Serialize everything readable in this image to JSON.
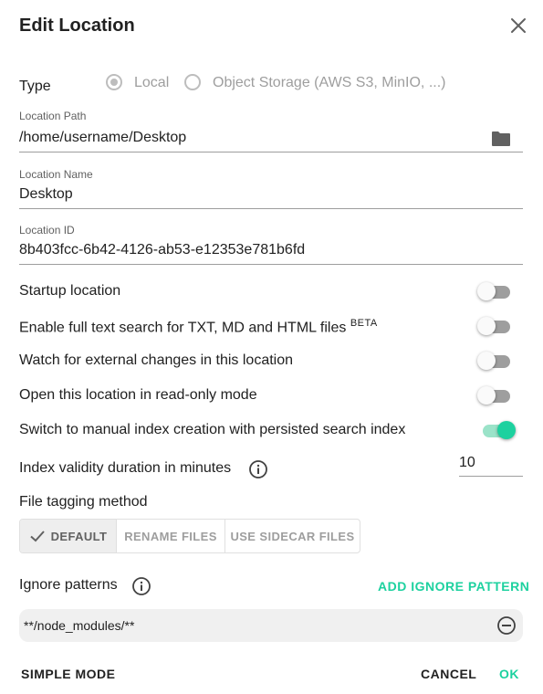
{
  "dialog": {
    "title": "Edit Location"
  },
  "type": {
    "label": "Type",
    "options": [
      {
        "label": "Local",
        "selected": true
      },
      {
        "label": "Object Storage (AWS S3, MinIO, ...)",
        "selected": false
      }
    ]
  },
  "fields": {
    "path": {
      "label": "Location Path",
      "value": "/home/username/Desktop"
    },
    "name": {
      "label": "Location Name",
      "value": "Desktop"
    },
    "id": {
      "label": "Location ID",
      "value": "8b403fcc-6b42-4126-ab53-e12353e781b6fd"
    }
  },
  "switches": [
    {
      "label": "Startup location",
      "on": false
    },
    {
      "label": "Enable full text search for TXT, MD and HTML files",
      "badge": "BETA",
      "on": false
    },
    {
      "label": "Watch for external changes in this location",
      "on": false
    },
    {
      "label": "Open this location in read-only mode",
      "on": false
    },
    {
      "label": "Switch to manual index creation with persisted search index",
      "on": true
    }
  ],
  "index_validity": {
    "label": "Index validity duration in minutes",
    "value": "10"
  },
  "tagging": {
    "label": "File tagging method",
    "options": [
      {
        "label": "DEFAULT",
        "selected": true
      },
      {
        "label": "RENAME FILES",
        "selected": false
      },
      {
        "label": "USE SIDECAR FILES",
        "selected": false
      }
    ]
  },
  "ignore": {
    "label": "Ignore patterns",
    "add_label": "ADD IGNORE PATTERN",
    "patterns": [
      "**/node_modules/**"
    ]
  },
  "actions": {
    "simple_mode": "SIMPLE MODE",
    "cancel": "CANCEL",
    "ok": "OK"
  },
  "colors": {
    "accent": "#1dd19f",
    "text": "#212121",
    "muted": "#9e9e9e"
  }
}
